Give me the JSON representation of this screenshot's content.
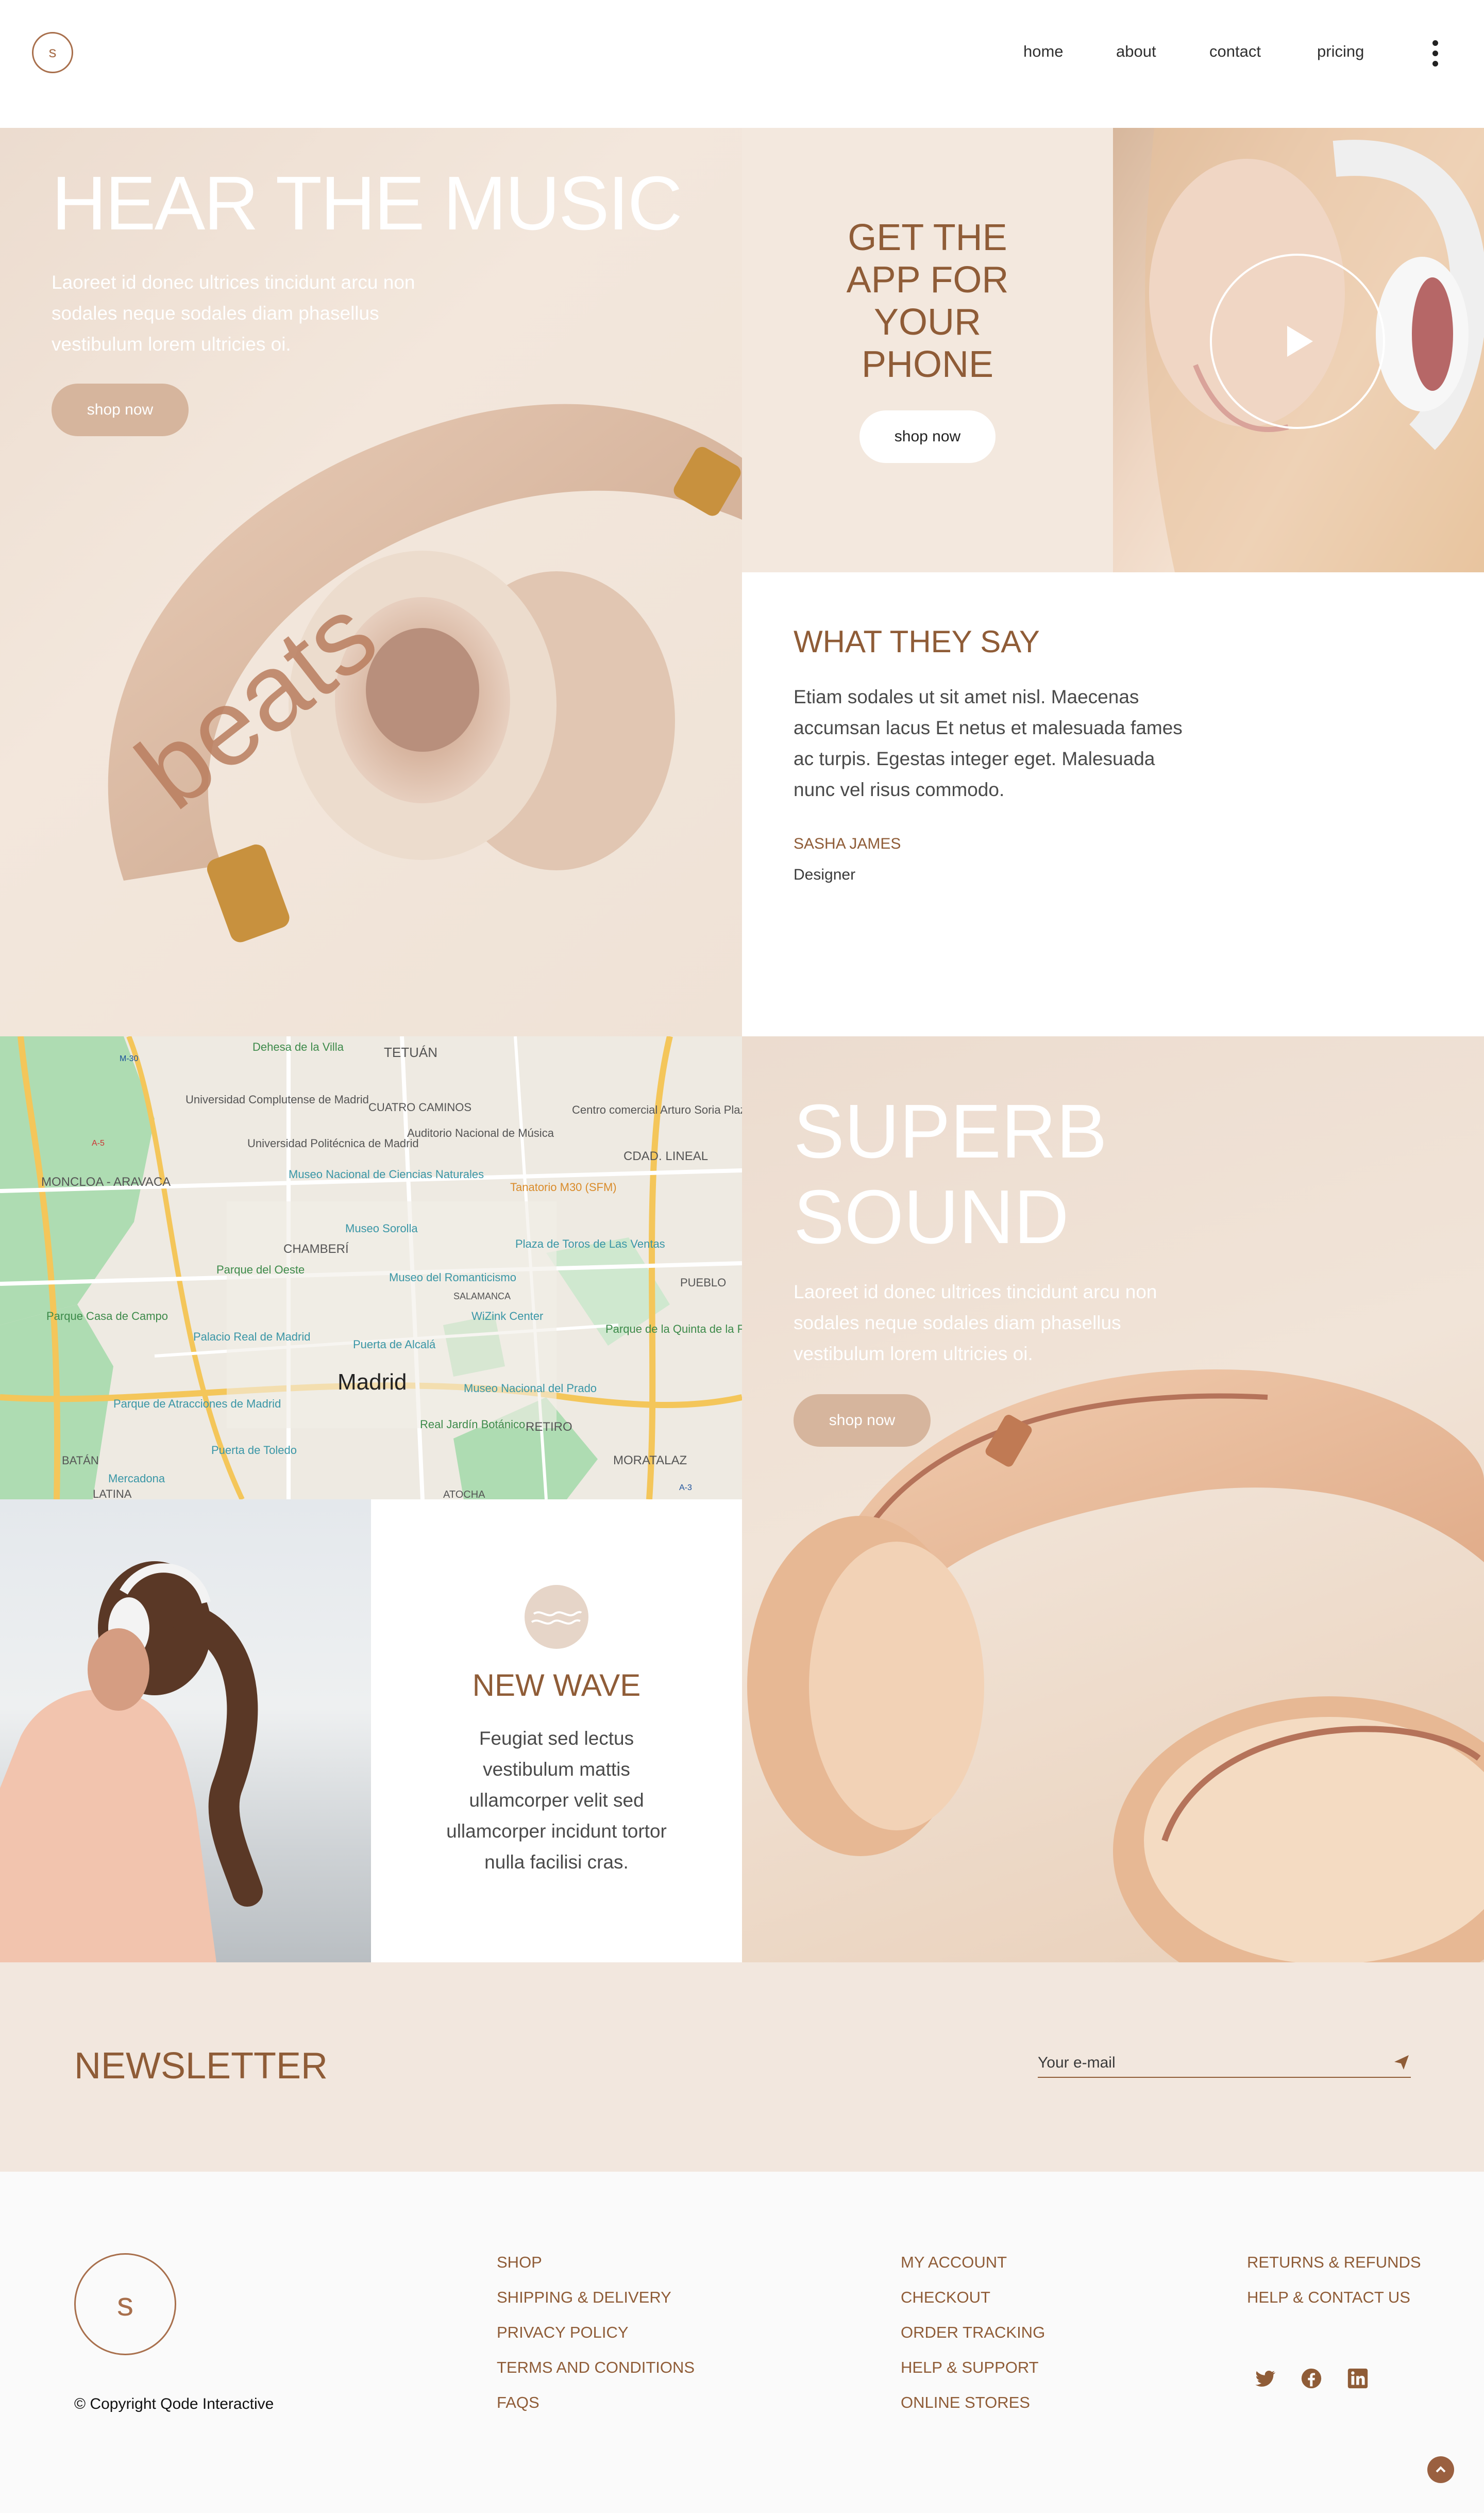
{
  "header": {
    "logo_letter": "s",
    "nav": [
      "home",
      "about",
      "contact",
      "pricing"
    ]
  },
  "hero": {
    "title": "HEAR THE MUSIC",
    "text": "Laoreet id donec ultrices tincidunt arcu non sodales neque sodales diam phasellus vestibulum lorem ultricies oi.",
    "button": "shop now",
    "product_brand": "beats"
  },
  "app_promo": {
    "title_lines": [
      "GET THE",
      "APP FOR",
      "YOUR",
      "PHONE"
    ],
    "button": "shop now"
  },
  "testimonial": {
    "title": "WHAT THEY SAY",
    "text": "Etiam sodales ut sit amet nisl. Maecenas accumsan lacus Et netus et malesuada fames ac turpis. Egestas integer eget. Malesuada nunc vel risus commodo.",
    "name": "SASHA JAMES",
    "role": "Designer"
  },
  "map": {
    "city": "Madrid",
    "labels": [
      "TETUÁN",
      "Dehesa de la Villa",
      "Universidad Complutense de Madrid",
      "CUATRO CAMINOS",
      "Universidad Politécnica de Madrid",
      "Auditorio Nacional de Música",
      "Centro comercial Arturo Soria Plaza",
      "MONCLOA - ARAVACA",
      "Museo Nacional de Ciencias Naturales",
      "Tanatorio M30 (SFM)",
      "CDAD. LINEAL",
      "Museo Sorolla",
      "CHAMBERÍ",
      "Plaza de Toros de Las Ventas",
      "Parque del Oeste",
      "Museo del Romanticismo",
      "PUEBLO",
      "SALAMANCA",
      "Parque Casa de Campo",
      "WiZink Center",
      "Palacio Real de Madrid",
      "Puerta de Alcalá",
      "Parque de la Quinta de la Fuente del Berro",
      "Museo Nacional del Prado",
      "Parque de Atracciones de Madrid",
      "Real Jardín Botánico",
      "RETIRO",
      "Puerta de Toledo",
      "BATÁN",
      "Mercadona",
      "MORATALAZ",
      "LATINA",
      "ATOCHA",
      "M-30",
      "A-5",
      "A-3"
    ]
  },
  "superb": {
    "title_lines": [
      "SUPERB",
      "SOUND"
    ],
    "text": "Laoreet id donec ultrices tincidunt arcu non sodales neque sodales diam phasellus vestibulum lorem ultricies oi.",
    "button": "shop now"
  },
  "new_wave": {
    "title": "NEW WAVE",
    "text": "Feugiat sed lectus vestibulum mattis ullamcorper velit sed ullamcorper incidunt tortor nulla facilisi cras."
  },
  "newsletter": {
    "title": "NEWSLETTER",
    "placeholder": "Your e-mail"
  },
  "footer": {
    "logo_letter": "s",
    "copyright": "© Copyright Qode Interactive",
    "col1": [
      "SHOP",
      "SHIPPING & DELIVERY",
      "PRIVACY POLICY",
      "TERMS AND CONDITIONS",
      "FAQS"
    ],
    "col2": [
      "MY ACCOUNT",
      "CHECKOUT",
      "ORDER TRACKING",
      "HELP & SUPPORT",
      "ONLINE STORES"
    ],
    "col3": [
      "RETURNS & REFUNDS",
      "HELP & CONTACT US"
    ],
    "social_icons": [
      "twitter-icon",
      "facebook-icon",
      "linkedin-icon"
    ]
  },
  "colors": {
    "accent": "#8f5c37",
    "accent_light": "#d6b59d",
    "panel_beige": "#f3e8de"
  }
}
